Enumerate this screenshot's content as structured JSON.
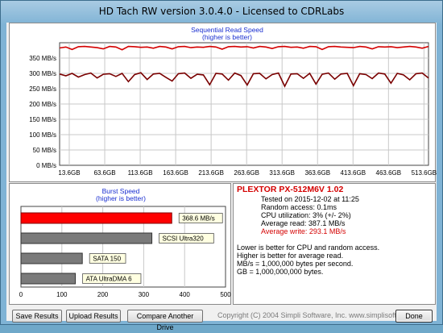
{
  "window": {
    "title": "HD Tach RW version 3.0.4.0 - Licensed to CDRLabs"
  },
  "read_chart": {
    "title": "Sequential Read Speed",
    "subtitle": "(higher is better)"
  },
  "burst_chart": {
    "title": "Burst Speed",
    "subtitle": "(higher is better)"
  },
  "info": {
    "drive": "PLEXTOR PX-512M6V 1.02",
    "tested_on": "Tested on 2015-12-02 at 11:25",
    "random_access": "Random access: 0.1ms",
    "cpu": "CPU utilization: 3% (+/- 2%)",
    "avg_read": "Average read: 387.1 MB/s",
    "avg_write": "Average write: 293.1 MB/s",
    "note1": "Lower is better for CPU and random access.",
    "note2": "Higher is better for average read.",
    "note3": "MB/s = 1,000,000 bytes per second.",
    "note4": "GB = 1,000,000,000 bytes."
  },
  "buttons": {
    "save": "Save Results",
    "upload": "Upload Results",
    "compare": "Compare Another Drive",
    "done": "Done"
  },
  "copyright": "Copyright (C) 2004 Simpli Software, Inc. www.simplisoftware.com",
  "colors": {
    "read_line": "#d40000",
    "write_line": "#7a0000",
    "bar_highlight": "#ff0000",
    "bar_other": "#7a7a7a"
  },
  "chart_data": [
    {
      "type": "line",
      "title": "Sequential Read Speed",
      "subtitle": "(higher is better)",
      "y_ticks": [
        "0 MB/s",
        "50 MB/s",
        "100 MB/s",
        "150 MB/s",
        "200 MB/s",
        "250 MB/s",
        "300 MB/s",
        "350 MB/s"
      ],
      "x_ticks": [
        "13.6GB",
        "63.6GB",
        "113.6GB",
        "163.6GB",
        "213.6GB",
        "263.6GB",
        "313.6GB",
        "363.6GB",
        "413.6GB",
        "463.6GB",
        "513.6GB"
      ],
      "ylim": [
        0,
        400
      ],
      "xlim": [
        0,
        520
      ],
      "grid": true,
      "series": [
        {
          "values": [
            383,
            386,
            378,
            387,
            388,
            386,
            384,
            380,
            388,
            386,
            377,
            388,
            387,
            385,
            386,
            382,
            388,
            386,
            380,
            387,
            388,
            384,
            386,
            385,
            388,
            386,
            379,
            387,
            388,
            386,
            387,
            383,
            388,
            386,
            381,
            387,
            388,
            385,
            386,
            382,
            388,
            387,
            378,
            387,
            388,
            386,
            385,
            384,
            388,
            386,
            380,
            387,
            386,
            387,
            384,
            386,
            388,
            386,
            382,
            388
          ]
        },
        {
          "values": [
            298,
            292,
            300,
            288,
            296,
            301,
            285,
            297,
            299,
            290,
            300,
            273,
            296,
            302,
            280,
            298,
            300,
            287,
            275,
            299,
            301,
            284,
            297,
            295,
            263,
            300,
            298,
            278,
            301,
            293,
            262,
            299,
            300,
            282,
            296,
            301,
            258,
            298,
            299,
            284,
            300,
            265,
            297,
            301,
            281,
            298,
            300,
            260,
            299,
            296,
            283,
            301,
            298,
            268,
            300,
            295,
            279,
            299,
            301,
            285
          ]
        }
      ]
    },
    {
      "type": "bar",
      "title": "Burst Speed",
      "subtitle": "(higher is better)",
      "categories": [
        "368.6 MB/s",
        "SCSI Ultra320",
        "SATA 150",
        "ATA UltraDMA 6"
      ],
      "values": [
        368.6,
        320,
        150,
        133
      ],
      "x_ticks": [
        "0",
        "100",
        "200",
        "300",
        "400",
        "500"
      ],
      "xlim": [
        0,
        500
      ],
      "grid": true
    }
  ]
}
